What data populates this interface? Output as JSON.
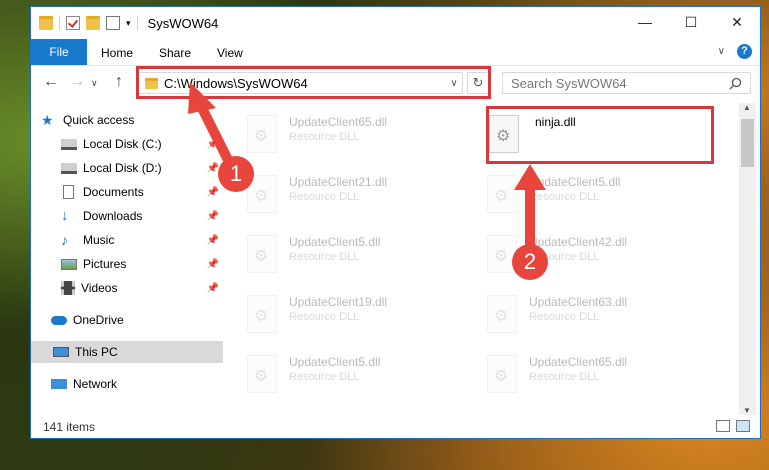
{
  "window": {
    "title": "SysWOW64"
  },
  "controls": {
    "minimize": "—",
    "maximize": "☐",
    "close": "✕"
  },
  "ribbon": {
    "file": "File",
    "home": "Home",
    "share": "Share",
    "view": "View",
    "help": "?",
    "expand": "∨"
  },
  "nav_buttons": {
    "back": "←",
    "forward": "→",
    "recent": "∨",
    "up": "↑"
  },
  "address": {
    "path": "C:\\Windows\\SysWOW64",
    "dropdown": "∨",
    "refresh": "↻"
  },
  "search": {
    "placeholder": "Search SysWOW64",
    "icon": "search-icon"
  },
  "sidebar": {
    "items": [
      {
        "label": "Quick access",
        "icon": "star-icon"
      },
      {
        "label": "Local Disk (C:)",
        "icon": "drive-icon"
      },
      {
        "label": "Local Disk (D:)",
        "icon": "drive-icon"
      },
      {
        "label": "Documents",
        "icon": "documents-icon"
      },
      {
        "label": "Downloads",
        "icon": "download-icon"
      },
      {
        "label": "Music",
        "icon": "music-icon"
      },
      {
        "label": "Pictures",
        "icon": "pictures-icon"
      },
      {
        "label": "Videos",
        "icon": "videos-icon"
      },
      {
        "label": "OneDrive",
        "icon": "cloud-icon"
      },
      {
        "label": "This PC",
        "icon": "pc-icon"
      },
      {
        "label": "Network",
        "icon": "network-icon"
      }
    ]
  },
  "files": [
    {
      "name": "UpdateClient65.dll",
      "type": "Resource DLL"
    },
    {
      "name": "ninja.dll",
      "type": ""
    },
    {
      "name": "UpdateClient21.dll",
      "type": "Resource DLL"
    },
    {
      "name": "UpdateClient5.dll",
      "type": "Resource DLL"
    },
    {
      "name": "UpdateClient5.dll",
      "type": "Resource DLL"
    },
    {
      "name": "UpdateClient42.dll",
      "type": "Resource DLL"
    },
    {
      "name": "UpdateClient19.dll",
      "type": "Resource DLL"
    },
    {
      "name": "UpdateClient63.dll",
      "type": "Resource DLL"
    },
    {
      "name": "UpdateClient5.dll",
      "type": "Resource DLL"
    },
    {
      "name": "UpdateClient65.dll",
      "type": "Resource DLL"
    }
  ],
  "status": {
    "count": "141 items"
  },
  "annotations": {
    "step1": "1",
    "step2": "2",
    "color": "#e8453c"
  },
  "colors": {
    "accent": "#1979ca",
    "highlight": "#d9363e"
  }
}
